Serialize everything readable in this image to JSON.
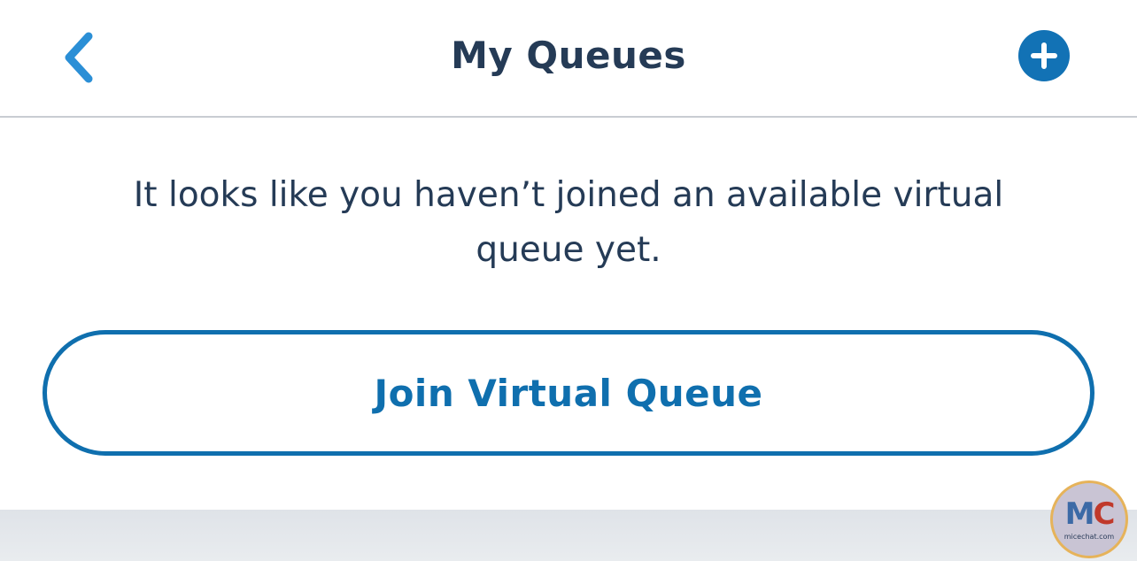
{
  "header": {
    "title": "My Queues",
    "back_icon": "chevron-left-icon",
    "add_icon": "plus-circle-icon"
  },
  "main": {
    "empty_message": "It looks like you haven’t joined an available virtual queue yet.",
    "join_button_label": "Join Virtual Queue"
  },
  "watermark": {
    "logo_m": "M",
    "logo_c": "C",
    "site": "micechat.com"
  },
  "colors": {
    "accent": "#0f6fae",
    "title": "#253b56",
    "divider": "#c9cdd2"
  }
}
